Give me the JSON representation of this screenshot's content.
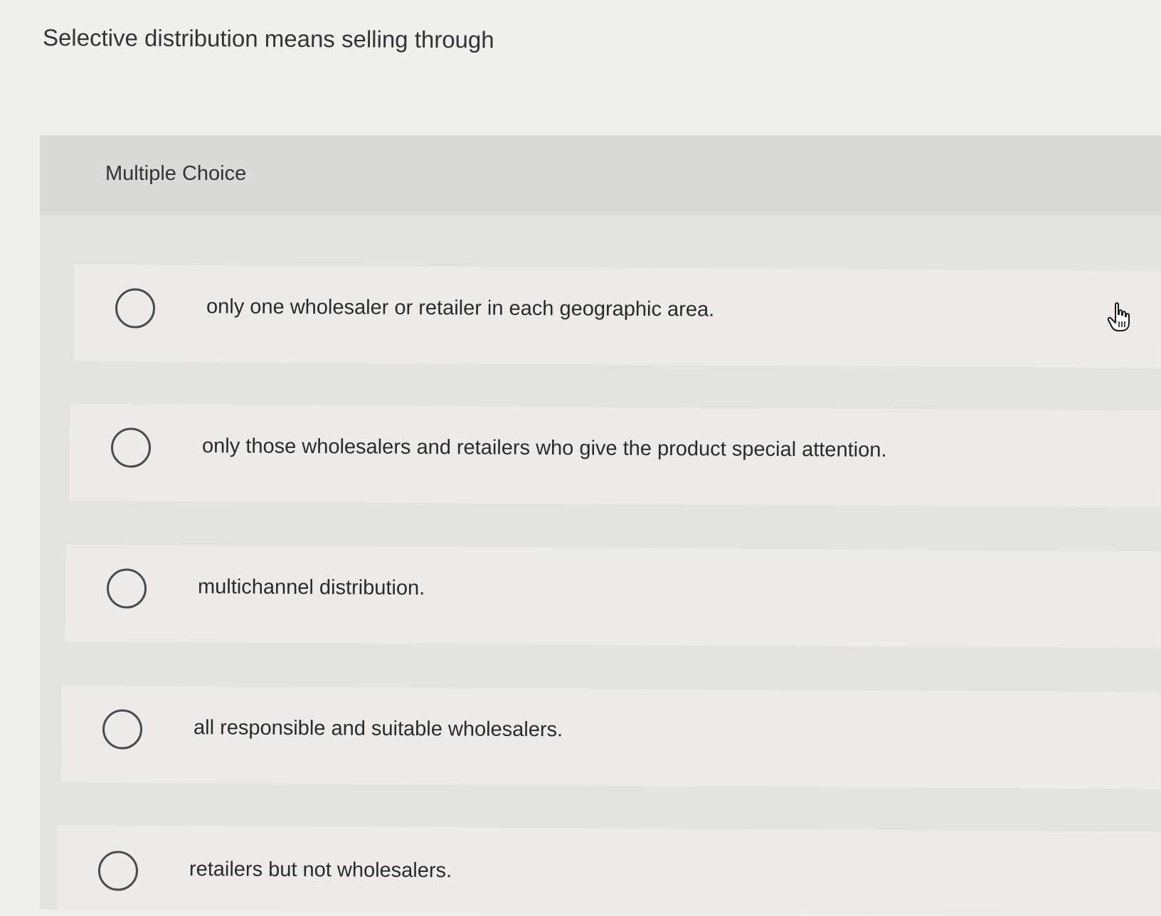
{
  "question": {
    "stem": "Selective distribution means selling through"
  },
  "multiple_choice": {
    "label": "Multiple Choice",
    "options": [
      {
        "label": "only one wholesaler or retailer in each geographic area.",
        "selected": false
      },
      {
        "label": "only those wholesalers and retailers who give the product special attention.",
        "selected": false
      },
      {
        "label": "multichannel distribution.",
        "selected": false
      },
      {
        "label": "all responsible and suitable wholesalers.",
        "selected": false
      },
      {
        "label": "retailers but not wholesalers.",
        "selected": false
      }
    ]
  },
  "cursor": {
    "icon": "hand-pointer-icon"
  }
}
